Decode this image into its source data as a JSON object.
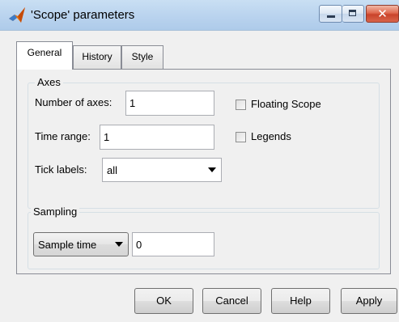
{
  "window": {
    "title": "'Scope' parameters",
    "minimize_label": "",
    "maximize_label": "",
    "close_label": "✕"
  },
  "tabs": [
    {
      "label": "General",
      "selected": true
    },
    {
      "label": "History",
      "selected": false
    },
    {
      "label": "Style",
      "selected": false
    }
  ],
  "axes": {
    "group_title": "Axes",
    "num_axes_label": "Number of axes:",
    "num_axes_value": "1",
    "time_range_label": "Time range:",
    "time_range_value": "1",
    "tick_labels_label": "Tick labels:",
    "tick_labels_value": "all",
    "floating_scope_label": "Floating Scope",
    "floating_scope_checked": false,
    "legends_label": "Legends",
    "legends_checked": false
  },
  "sampling": {
    "group_title": "Sampling",
    "mode_value": "Sample time",
    "value": "0"
  },
  "buttons": {
    "ok": "OK",
    "cancel": "Cancel",
    "help": "Help",
    "apply": "Apply"
  },
  "colors": {
    "titlebar": "#bcd5ef",
    "close_button": "#c9432a",
    "dialog_background": "#f0f0f0",
    "matlab_icon_orange": "#e8720c"
  },
  "icons": {
    "app": "matlab-logo-icon",
    "minimize": "minimize-icon",
    "maximize": "maximize-icon",
    "close": "close-icon",
    "dropdown": "chevron-down-icon"
  }
}
